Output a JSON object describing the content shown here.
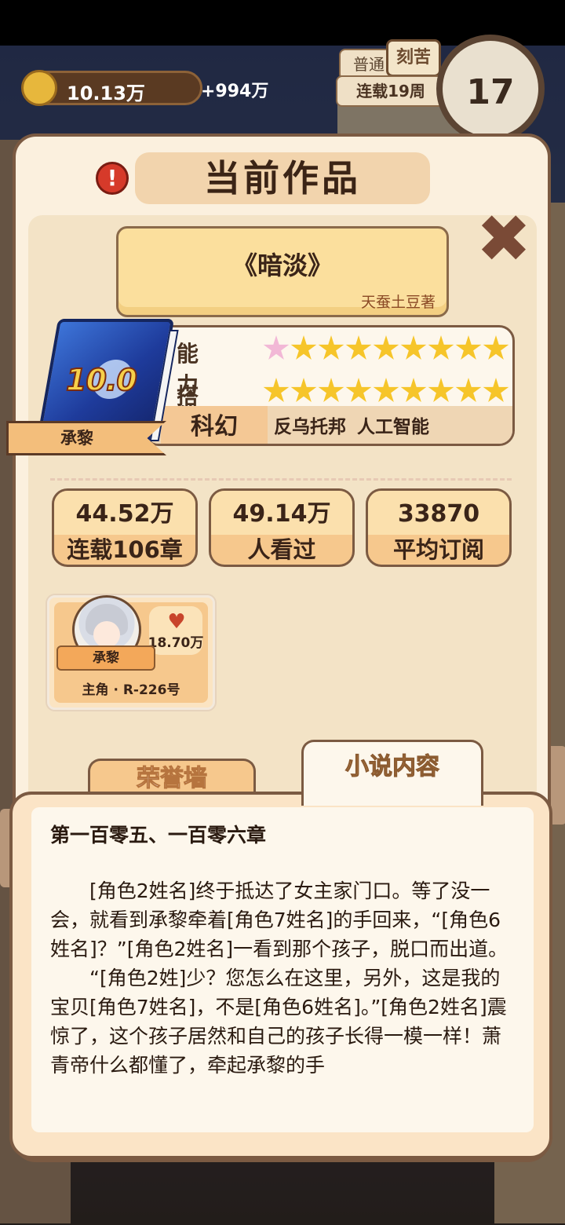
{
  "hud": {
    "coins": "10.13万",
    "rate": "+994万",
    "mode": "普通",
    "difficulty": "刻苦",
    "day": "连载19周",
    "clock": "17"
  },
  "dialog": {
    "title": "当前作品",
    "alert_icon": "!",
    "close_icon": "✖"
  },
  "book": {
    "title": "《暗淡》",
    "author": "天蚕土豆著",
    "score": "10.0",
    "protagonist_ribbon": "承黎",
    "ability_label": "能力值",
    "ability_stars": 9,
    "match_label": "搭配度",
    "match_stars": 9,
    "genre": "科幻",
    "tags": [
      "反乌托邦",
      "人工智能"
    ]
  },
  "metrics": [
    {
      "value": "44.52万",
      "label": "连载106章"
    },
    {
      "value": "49.14万",
      "label": "人看过"
    },
    {
      "value": "33870",
      "label": "平均订阅"
    }
  ],
  "character": {
    "name": "承黎",
    "favor": "18.70万",
    "role": "主角 · R-226号",
    "icons": [
      "avatar-icon",
      "heart-icon"
    ]
  },
  "tabs": {
    "honor": "荣誉墙",
    "content": "小说内容"
  },
  "chapter": {
    "title": "第一百零五、一百零六章",
    "paragraphs": [
      "[角色2姓名]终于抵达了女主家门口。等了没一会，就看到承黎牵着[角色7姓名]的手回来，“[角色6姓名]？”[角色2姓名]一看到那个孩子，脱口而出道。",
      "“[角色2姓]少？您怎么在这里，另外，这是我的宝贝[角色7姓名]，不是[角色6姓名]。”[角色2姓名]震惊了，这个孩子居然和自己的孩子长得一模一样！萧青帝什么都懂了，牵起承黎的手"
    ]
  },
  "colors": {
    "panel_bg": "#fbf0de",
    "border": "#7b5a42",
    "accent_orange": "#f6c88d",
    "star_gold": "#f6c52a",
    "star_pink": "#f2b8d6"
  }
}
